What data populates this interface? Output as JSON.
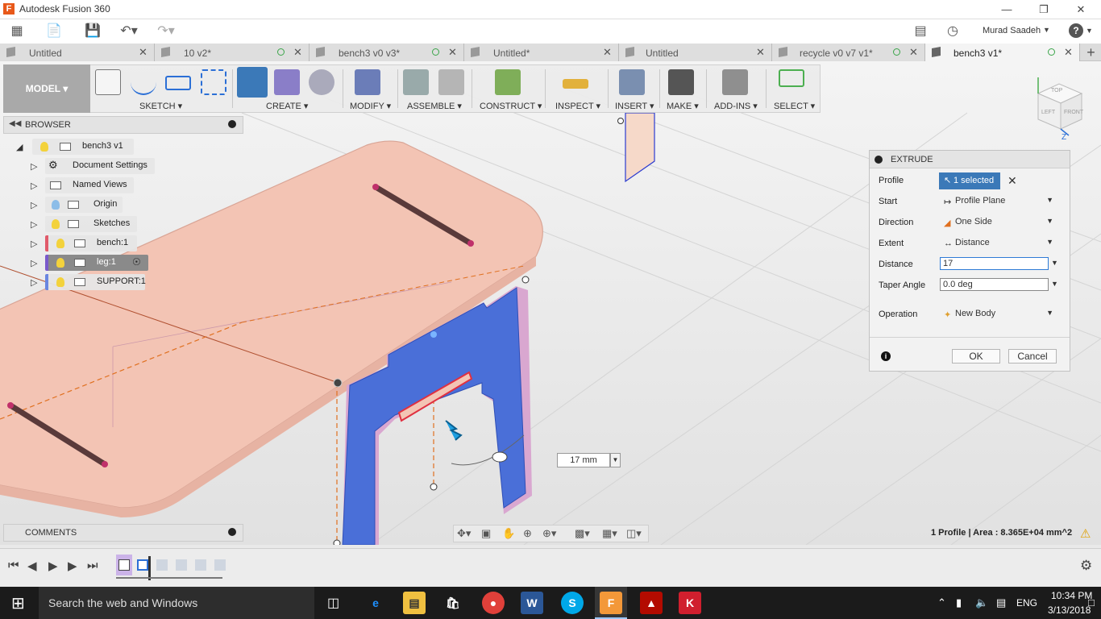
{
  "app": {
    "title": "Autodesk Fusion 360",
    "logo": "F",
    "user": "Murad Saadeh",
    "help": "?"
  },
  "quick_access": {
    "icons": [
      "grid-icon",
      "file-icon",
      "save-icon",
      "undo-icon",
      "redo-icon",
      "notification-icon",
      "clock-icon",
      "help-icon"
    ]
  },
  "tabs": [
    {
      "label": "Untitled",
      "status_dot": false,
      "active": false
    },
    {
      "label": "10 v2*",
      "status_dot": true,
      "active": false
    },
    {
      "label": "bench3 v0 v3*",
      "status_dot": true,
      "active": false
    },
    {
      "label": "Untitled*",
      "status_dot": false,
      "active": false
    },
    {
      "label": "Untitled",
      "status_dot": false,
      "active": false
    },
    {
      "label": "recycle v0 v7 v1*",
      "status_dot": true,
      "active": false
    },
    {
      "label": "bench3 v1*",
      "status_dot": true,
      "active": true
    }
  ],
  "toolbar": {
    "workspace": "MODEL ▾",
    "groups": [
      "SKETCH ▾",
      "CREATE ▾",
      "MODIFY ▾",
      "ASSEMBLE ▾",
      "CONSTRUCT ▾",
      "INSPECT ▾",
      "INSERT ▾",
      "MAKE ▾",
      "ADD-INS ▾",
      "SELECT ▾"
    ]
  },
  "browser": {
    "title": "BROWSER",
    "root": "bench3 v1",
    "items": [
      {
        "label": "Document Settings",
        "icon": "gear-icon"
      },
      {
        "label": "Named Views",
        "icon": "folder-icon"
      },
      {
        "label": "Origin",
        "icon": "folder-icon"
      },
      {
        "label": "Sketches",
        "icon": "folder-icon"
      },
      {
        "label": "bench:1",
        "icon": "component-icon"
      },
      {
        "label": "leg:1",
        "icon": "component-icon"
      },
      {
        "label": "SUPPORT:1",
        "icon": "component-icon"
      }
    ]
  },
  "comments": {
    "title": "COMMENTS"
  },
  "extrude": {
    "title": "EXTRUDE",
    "profile_label": "Profile",
    "profile_value": "1 selected",
    "start_label": "Start",
    "start_value": "Profile Plane",
    "direction_label": "Direction",
    "direction_value": "One Side",
    "extent_label": "Extent",
    "extent_value": "Distance",
    "distance_label": "Distance",
    "distance_value": "17",
    "taper_label": "Taper Angle",
    "taper_value": "0.0 deg",
    "operation_label": "Operation",
    "operation_value": "New Body",
    "ok": "OK",
    "cancel": "Cancel",
    "info": "i"
  },
  "viewport": {
    "dimension_value": "17 mm",
    "viewcube": {
      "top": "TOP",
      "left": "LEFT",
      "front": "FRONT"
    },
    "axis_z": "Z"
  },
  "status": {
    "text": "1 Profile | Area : 8.365E+04 mm^2"
  },
  "taskbar": {
    "search": "Search the web and Windows",
    "lang": "ENG",
    "time": "10:34 PM",
    "date": "3/13/2018"
  },
  "colors": {
    "accent": "#3b79b8",
    "bench": "#f3c4b4",
    "leg": "#4a6fd8",
    "taskbar": "#1b1b1b"
  }
}
